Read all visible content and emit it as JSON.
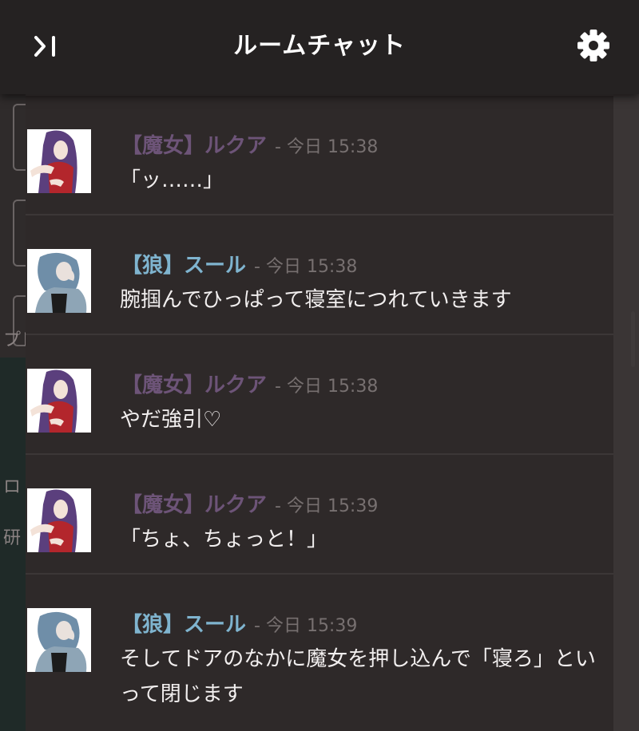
{
  "header": {
    "title": "ルームチャット"
  },
  "background": {
    "fragments": [
      "プレ",
      "ロ",
      "研"
    ]
  },
  "messages": [
    {
      "sender": "【魔女】ルクア",
      "meta": "- 今日 15:38",
      "text": "「ッ……」",
      "avatar": "witch-avatar"
    },
    {
      "sender": "【狼】スール",
      "meta": "- 今日 15:38",
      "text": "腕掴んでひっぱって寝室につれていきます",
      "avatar": "wolf-avatar"
    },
    {
      "sender": "【魔女】ルクア",
      "meta": "- 今日 15:38",
      "text": "やだ強引♡",
      "avatar": "witch-avatar"
    },
    {
      "sender": "【魔女】ルクア",
      "meta": "- 今日 15:39",
      "text": "「ちょ、ちょっと！」",
      "avatar": "witch-avatar"
    },
    {
      "sender": "【狼】スール",
      "meta": "- 今日 15:39",
      "text": "そしてドアのなかに魔女を押し込んで「寝ろ」といって閉じます",
      "avatar": "wolf-avatar"
    }
  ],
  "colors": {
    "witch_name": "#6d5478",
    "wolf_name": "#7fb4cf",
    "meta": "#777070",
    "header_bg": "#252222",
    "panel_bg": "#2e2929"
  },
  "icons": {
    "collapse": "collapse-panel-icon",
    "settings": "gear-icon"
  }
}
